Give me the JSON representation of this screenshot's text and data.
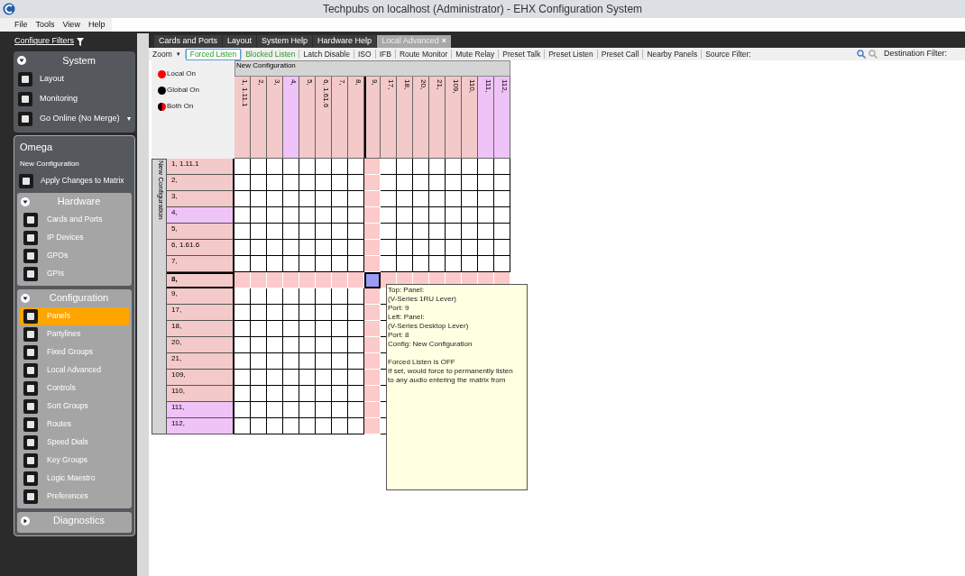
{
  "window": {
    "title": "Techpubs on localhost (Administrator) - EHX Configuration System"
  },
  "menu": [
    "File",
    "Tools",
    "View",
    "Help"
  ],
  "sidebar": {
    "filter_label": "Configure Filters",
    "system": {
      "title": "System",
      "expanded": true,
      "items": [
        {
          "label": "Layout"
        },
        {
          "label": "Monitoring"
        },
        {
          "label": "Go Online (No Merge)",
          "dropdown_glyph": "▾"
        }
      ]
    },
    "omega": {
      "title": "Omega",
      "subtitle": "New Configuration",
      "apply": "Apply Changes to Matrix",
      "groups": [
        {
          "title": "Hardware",
          "expanded": true,
          "items": [
            {
              "label": "Cards and Ports",
              "selected": false
            },
            {
              "label": "IP Devices",
              "selected": false
            },
            {
              "label": "GPOs",
              "selected": false
            },
            {
              "label": "GPIs",
              "selected": false
            }
          ]
        },
        {
          "title": "Configuration",
          "expanded": true,
          "items": [
            {
              "label": "Panels",
              "selected": true
            },
            {
              "label": "Partylines",
              "selected": false
            },
            {
              "label": "Fixed Groups",
              "selected": false
            },
            {
              "label": "Local Advanced",
              "selected": false
            },
            {
              "label": "Controls",
              "selected": false
            },
            {
              "label": "Sort Groups",
              "selected": false
            },
            {
              "label": "Routes",
              "selected": false
            },
            {
              "label": "Speed Dials",
              "selected": false
            },
            {
              "label": "Key Groups",
              "selected": false
            },
            {
              "label": "Logic Maestro",
              "selected": false
            },
            {
              "label": "Preferences",
              "selected": false
            }
          ]
        },
        {
          "title": "Diagnostics",
          "expanded": false
        }
      ]
    }
  },
  "tabs": [
    {
      "label": "Cards and Ports",
      "selected": false
    },
    {
      "label": "Layout",
      "selected": false
    },
    {
      "label": "System Help",
      "selected": false
    },
    {
      "label": "Hardware Help",
      "selected": false
    },
    {
      "label": "Local Advanced",
      "selected": true,
      "close_glyph": "×"
    }
  ],
  "toolbar": [
    {
      "label": "Zoom",
      "kind": "dropdown",
      "caret": "▼",
      "on": false,
      "selected": false
    },
    {
      "label": "Forced Listen",
      "kind": "mode",
      "on": true,
      "selected": true
    },
    {
      "label": "Blocked Listen",
      "kind": "mode",
      "on": true,
      "selected": false
    },
    {
      "label": "Latch Disable",
      "kind": "mode",
      "on": false,
      "selected": false
    },
    {
      "label": "ISO",
      "kind": "mode",
      "on": false,
      "selected": false
    },
    {
      "label": "IFB",
      "kind": "mode",
      "on": false,
      "selected": false
    },
    {
      "label": "Route Monitor",
      "kind": "mode",
      "on": false,
      "selected": false
    },
    {
      "label": "Mute Relay",
      "kind": "mode",
      "on": false,
      "selected": false
    },
    {
      "label": "Preset Talk",
      "kind": "mode",
      "on": false,
      "selected": false
    },
    {
      "label": "Preset Listen",
      "kind": "mode",
      "on": false,
      "selected": false
    },
    {
      "label": "Preset Call",
      "kind": "mode",
      "on": false,
      "selected": false
    },
    {
      "label": "Nearby Panels",
      "kind": "mode",
      "on": false,
      "selected": false
    },
    {
      "label": "Source Filter:",
      "kind": "filter",
      "on": false,
      "selected": false
    }
  ],
  "destination_filter": "Destination Filter:",
  "legend": [
    {
      "label": "Local On",
      "kind": "local"
    },
    {
      "label": "Global On",
      "kind": "global"
    },
    {
      "label": "Both On",
      "kind": "both"
    }
  ],
  "matrix": {
    "column_group_label": "New Configuration",
    "row_group_label": "New Configuration",
    "columns": [
      {
        "label": "1, 1.11.1",
        "color": "#f4c9c9",
        "selected": false
      },
      {
        "label": "2,",
        "color": "#f4c9c9",
        "selected": false
      },
      {
        "label": "3,",
        "color": "#f4c9c9",
        "selected": false
      },
      {
        "label": "4,",
        "color": "#efc3f7",
        "selected": false
      },
      {
        "label": "5,",
        "color": "#f4c9c9",
        "selected": false
      },
      {
        "label": "6, 1.61.6",
        "color": "#f4c9c9",
        "selected": false
      },
      {
        "label": "7,",
        "color": "#f4c9c9",
        "selected": false
      },
      {
        "label": "8,",
        "color": "#f4c9c9",
        "selected": false
      },
      {
        "label": "9,",
        "color": "#f4c9c9",
        "selected": true
      },
      {
        "label": "17,",
        "color": "#f4c9c9",
        "selected": false
      },
      {
        "label": "18,",
        "color": "#f4c9c9",
        "selected": false
      },
      {
        "label": "20,",
        "color": "#f4c9c9",
        "selected": false
      },
      {
        "label": "21,",
        "color": "#f4c9c9",
        "selected": false
      },
      {
        "label": "109,",
        "color": "#f4c9c9",
        "selected": false
      },
      {
        "label": "110,",
        "color": "#f4c9c9",
        "selected": false
      },
      {
        "label": "111,",
        "color": "#efc3f7",
        "selected": false
      },
      {
        "label": "112,",
        "color": "#efc3f7",
        "selected": false
      }
    ],
    "rows": [
      {
        "label": "1, 1.11.1",
        "color": "#f4c9c9",
        "selected": false
      },
      {
        "label": "2,",
        "color": "#f4c9c9",
        "selected": false
      },
      {
        "label": "3,",
        "color": "#f4c9c9",
        "selected": false
      },
      {
        "label": "4,",
        "color": "#efc3f7",
        "selected": false
      },
      {
        "label": "5,",
        "color": "#f4c9c9",
        "selected": false
      },
      {
        "label": "6, 1.61.6",
        "color": "#f4c9c9",
        "selected": false
      },
      {
        "label": "7,",
        "color": "#f4c9c9",
        "selected": false
      },
      {
        "label": "8,",
        "color": "#f4c9c9",
        "selected": true
      },
      {
        "label": "9,",
        "color": "#f4c9c9",
        "selected": false
      },
      {
        "label": "17,",
        "color": "#f4c9c9",
        "selected": false
      },
      {
        "label": "18,",
        "color": "#f4c9c9",
        "selected": false
      },
      {
        "label": "20,",
        "color": "#f4c9c9",
        "selected": false
      },
      {
        "label": "21,",
        "color": "#f4c9c9",
        "selected": false
      },
      {
        "label": "109,",
        "color": "#f4c9c9",
        "selected": false
      },
      {
        "label": "110,",
        "color": "#f4c9c9",
        "selected": false
      },
      {
        "label": "111,",
        "color": "#efc3f7",
        "selected": false
      },
      {
        "label": "112,",
        "color": "#efc3f7",
        "selected": false
      }
    ]
  },
  "tooltip": {
    "details": [
      "Top: Panel:",
      "(V-Series 1RU Lever)",
      "Port: 9",
      "Left: Panel:",
      "(V-Series Desktop Lever)",
      "Port: 8",
      "Config: New Configuration"
    ],
    "note": [
      "Forced Listen is OFF",
      "If set, would force  to permanently listen to any audio entering the matrix from"
    ]
  }
}
